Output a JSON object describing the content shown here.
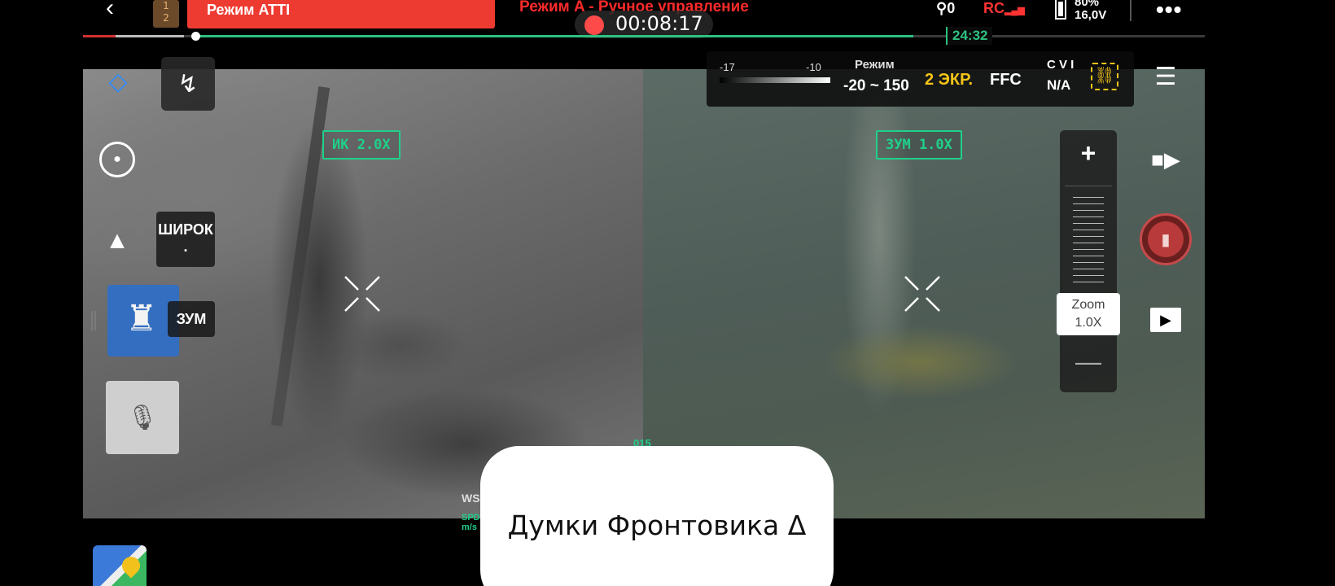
{
  "topbar": {
    "back_icon": "chevron-left-icon",
    "battery_pair": [
      "1",
      "2"
    ],
    "mode_badge": "Режим ATTI",
    "flight_mode": "Режим A - Ручное управление",
    "rec_time": "00:08:17",
    "gps_count": "0",
    "rc_label": "RC",
    "battery_percent": "80%",
    "battery_voltage": "16,0V",
    "more_icon": "•••"
  },
  "playback": {
    "flight_time": "24:32",
    "progress_fraction": 0.09,
    "green_span_fraction": [
      0.1,
      0.74
    ]
  },
  "thermal_panel": {
    "min_label": "-17",
    "mid_label": "-10",
    "mode_label": "Режим",
    "range": "-20 ~ 150",
    "screens": "2 ЭКР.",
    "ffc": "FFC",
    "cvi": "C V I",
    "na": "N/A"
  },
  "views": {
    "ir_label": "ИК 2.0X",
    "zoom_label": "ЗУМ 1.0X"
  },
  "left_controls": {
    "wide_label": "ШИРОК",
    "wide_sub": ".",
    "zoom_label": "ЗУМ"
  },
  "zoom_slider": {
    "plus": "+",
    "minus": "—",
    "title": "Zoom",
    "value": "1.0X"
  },
  "telemetry": {
    "ws": "WS",
    "spd": "SPD",
    "spd_unit": "m/s",
    "partial_number": "015"
  },
  "caption": {
    "text": "Думки Фронтовика Δ"
  },
  "colors": {
    "accent_green": "#1fd08a",
    "alert_red": "#ee3b32",
    "warning_yellow": "#f5c518",
    "ui_blue": "#2f6fc8"
  }
}
